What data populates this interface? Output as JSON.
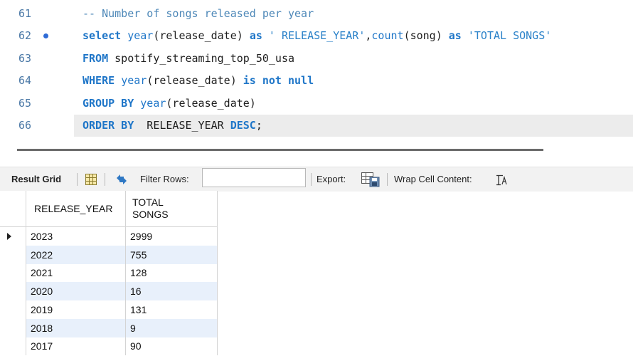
{
  "editor": {
    "lines": [
      {
        "num": "61",
        "parts": [
          {
            "t": "-- Number of songs released per year",
            "c": "cmt"
          }
        ]
      },
      {
        "num": "62",
        "breakpoint": true,
        "parts": [
          {
            "t": "select ",
            "c": "kw"
          },
          {
            "t": "year",
            "c": "fn"
          },
          {
            "t": "(release_date) ",
            "c": ""
          },
          {
            "t": "as ",
            "c": "kw"
          },
          {
            "t": "' RELEASE_YEAR'",
            "c": "str"
          },
          {
            "t": ",",
            "c": ""
          },
          {
            "t": "count",
            "c": "fn"
          },
          {
            "t": "(song) ",
            "c": ""
          },
          {
            "t": "as ",
            "c": "kw"
          },
          {
            "t": "'TOTAL SONGS'",
            "c": "str"
          }
        ]
      },
      {
        "num": "63",
        "parts": [
          {
            "t": "FROM ",
            "c": "kw"
          },
          {
            "t": "spotify_streaming_top_50_usa",
            "c": ""
          }
        ]
      },
      {
        "num": "64",
        "parts": [
          {
            "t": "WHERE ",
            "c": "kw"
          },
          {
            "t": "year",
            "c": "fn"
          },
          {
            "t": "(release_date) ",
            "c": ""
          },
          {
            "t": "is not null",
            "c": "kw"
          }
        ]
      },
      {
        "num": "65",
        "parts": [
          {
            "t": "GROUP BY ",
            "c": "kw"
          },
          {
            "t": "year",
            "c": "fn"
          },
          {
            "t": "(release_date)",
            "c": ""
          }
        ]
      },
      {
        "num": "66",
        "current": true,
        "parts": [
          {
            "t": "ORDER BY ",
            "c": "kw"
          },
          {
            "t": " RELEASE_YEAR ",
            "c": ""
          },
          {
            "t": "DESC",
            "c": "kw"
          },
          {
            "t": ";",
            "c": ""
          }
        ]
      }
    ]
  },
  "toolbar": {
    "result_grid_label": "Result Grid",
    "filter_rows_label": "Filter Rows:",
    "filter_value": "",
    "export_label": "Export:",
    "wrap_label": "Wrap Cell Content:"
  },
  "grid": {
    "columns": [
      "RELEASE_YEAR",
      "TOTAL\nSONGS"
    ],
    "rows": [
      [
        "2023",
        "2999"
      ],
      [
        "2022",
        "755"
      ],
      [
        "2021",
        "128"
      ],
      [
        "2020",
        "16"
      ],
      [
        "2019",
        "131"
      ],
      [
        "2018",
        "9"
      ],
      [
        "2017",
        "90"
      ]
    ],
    "selected_row": 0
  },
  "colors": {
    "keyword": "#1f76c8",
    "row_alt": "#e8f0fb"
  },
  "icons": [
    "grid-view-icon",
    "refresh-icon",
    "export-icon",
    "wrap-text-icon",
    "row-pointer-icon"
  ]
}
